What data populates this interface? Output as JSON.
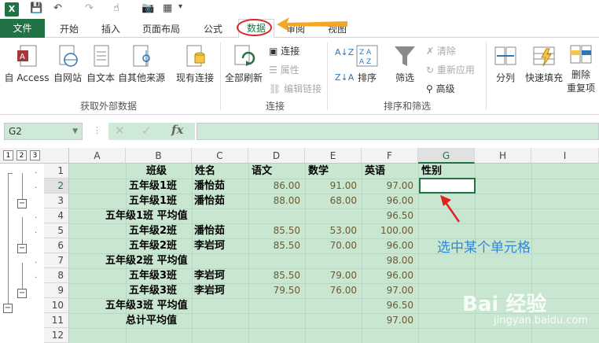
{
  "qat": {
    "app_icon": "X"
  },
  "tabs": {
    "file": "文件",
    "items": [
      "开始",
      "插入",
      "页面布局",
      "公式",
      "数据",
      "审阅",
      "视图"
    ]
  },
  "ribbon": {
    "get_external": {
      "buttons": [
        "自 Access",
        "自网站",
        "自文本",
        "自其他来源",
        "现有连接"
      ],
      "label": "获取外部数据"
    },
    "connections": {
      "refresh": "全部刷新",
      "connect": "连接",
      "properties": "属性",
      "edit_links": "编辑链接",
      "label": "连接"
    },
    "sort_filter": {
      "sort": "排序",
      "filter": "筛选",
      "clear": "清除",
      "reapply": "重新应用",
      "advanced": "高级",
      "label": "排序和筛选"
    },
    "tools": {
      "split": "分列",
      "flash_fill": "快速填充",
      "remove_dup_1": "删除",
      "remove_dup_2": "重复项"
    }
  },
  "formula_bar": {
    "name_box": "G2",
    "fx": "fx"
  },
  "columns": [
    "A",
    "B",
    "C",
    "D",
    "E",
    "F",
    "G",
    "H",
    "I"
  ],
  "outline_levels": [
    "1",
    "2",
    "3"
  ],
  "rows": [
    {
      "n": "1",
      "b": "班级",
      "c": "姓名",
      "d": "语文",
      "e": "数学",
      "f": "英语",
      "g": "性别",
      "header": true
    },
    {
      "n": "2",
      "b": "五年级1班",
      "c": "潘怡茹",
      "d": "86.00",
      "e": "91.00",
      "f": "97.00"
    },
    {
      "n": "3",
      "b": "五年级1班",
      "c": "潘怡茹",
      "d": "88.00",
      "e": "68.00",
      "f": "96.00"
    },
    {
      "n": "4",
      "a": "五年级1班 平均值",
      "f": "96.50"
    },
    {
      "n": "5",
      "b": "五年级2班",
      "c": "潘怡茹",
      "d": "85.50",
      "e": "53.00",
      "f": "100.00"
    },
    {
      "n": "6",
      "b": "五年级2班",
      "c": "李岩珂",
      "d": "85.50",
      "e": "70.00",
      "f": "96.00"
    },
    {
      "n": "7",
      "a": "五年级2班 平均值",
      "f": "98.00"
    },
    {
      "n": "8",
      "b": "五年级3班",
      "c": "李岩珂",
      "d": "85.50",
      "e": "79.00",
      "f": "96.00"
    },
    {
      "n": "9",
      "b": "五年级3班",
      "c": "李岩珂",
      "d": "79.50",
      "e": "76.00",
      "f": "97.00"
    },
    {
      "n": "10",
      "a": "五年级3班 平均值",
      "f": "96.50"
    },
    {
      "n": "11",
      "a": "总计平均值",
      "f": "97.00"
    },
    {
      "n": "12"
    }
  ],
  "annotation": "选中某个单元格",
  "watermark": {
    "main": "Bai 经验",
    "sub": "jingyan.baidu.com"
  }
}
